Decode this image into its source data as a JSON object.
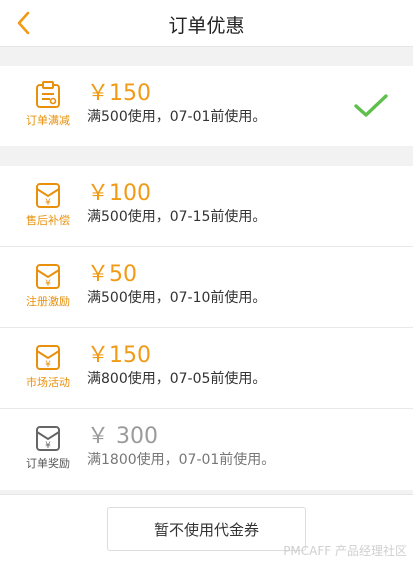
{
  "header": {
    "title": "订单优惠"
  },
  "selected": {
    "amount": "￥150",
    "desc": "满500使用，07-01前使用。",
    "label": "订单满减"
  },
  "coupons": [
    {
      "amount": "￥100",
      "desc": "满500使用，07-15前使用。",
      "label": "售后补偿"
    },
    {
      "amount": "￥50",
      "desc": "满500使用，07-10前使用。",
      "label": "注册激励"
    },
    {
      "amount": "￥150",
      "desc": "满800使用，07-05前使用。",
      "label": "市场活动"
    },
    {
      "amount": "￥ 300",
      "desc": "满1800使用，07-01前使用。",
      "label": "订单奖励"
    }
  ],
  "footer": {
    "button_label": "暂不使用代金券"
  },
  "watermark": "PMCAFF 产品经理社区",
  "colors": {
    "accent": "#f09a16",
    "check": "#5fbf4c",
    "disabled": "#9b9b9b"
  }
}
